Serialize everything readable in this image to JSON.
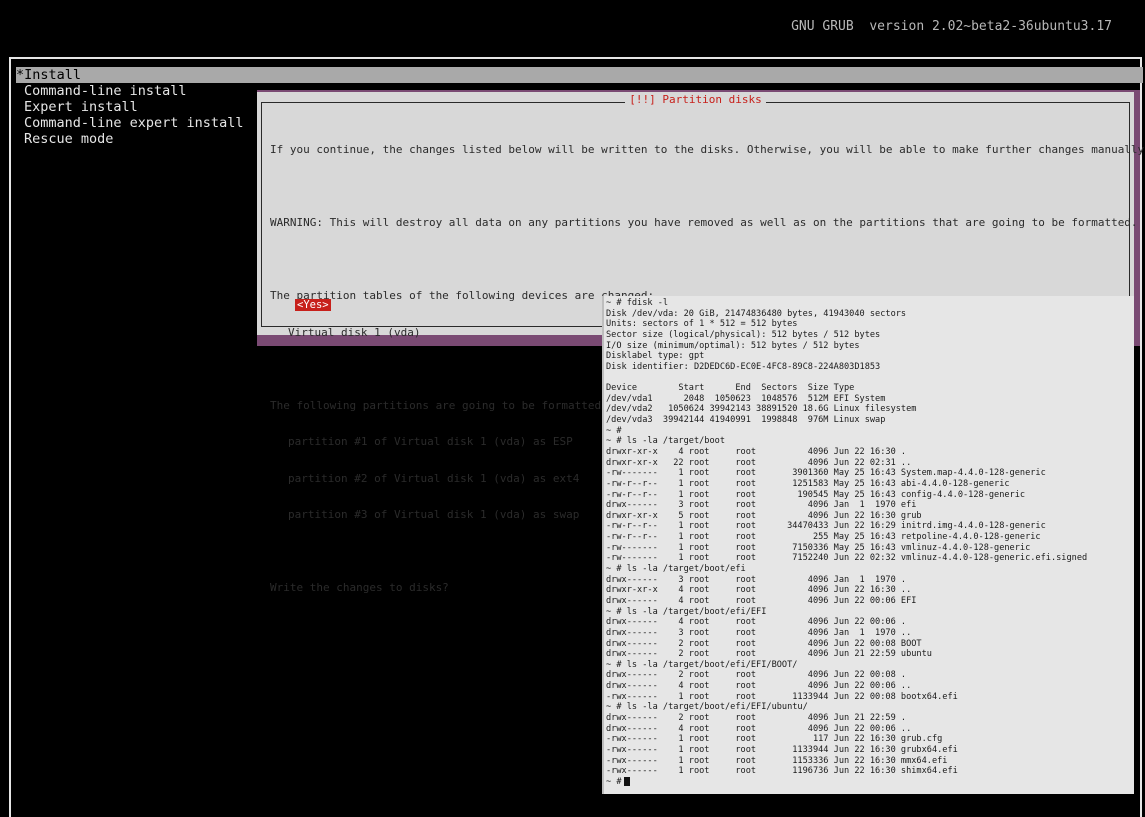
{
  "header": {
    "title": "GNU GRUB  version 2.02~beta2-36ubuntu3.17"
  },
  "menu": {
    "items": [
      {
        "label": "*Install",
        "selected": true
      },
      {
        "label": "Command-line install"
      },
      {
        "label": "Expert install"
      },
      {
        "label": "Command-line expert install"
      },
      {
        "label": "Rescue mode"
      }
    ]
  },
  "dialog": {
    "title": "[!!] Partition disks",
    "intro": "If you continue, the changes listed below will be written to the disks. Otherwise, you will be able to make further changes manually.",
    "warning": "WARNING: This will destroy all data on any partitions you have removed as well as on the partitions that are going to be formatted.",
    "tables_heading": "The partition tables of the following devices are changed:",
    "tables_device": "Virtual disk 1 (vda)",
    "format_heading": "The following partitions are going to be formatted:",
    "format_items": [
      "partition #1 of Virtual disk 1 (vda) as ESP",
      "partition #2 of Virtual disk 1 (vda) as ext4",
      "partition #3 of Virtual disk 1 (vda) as swap"
    ],
    "question": "Write the changes to disks?",
    "yes_label": "<Yes>"
  },
  "terminal": {
    "lines": [
      "~ # fdisk -l",
      "Disk /dev/vda: 20 GiB, 21474836480 bytes, 41943040 sectors",
      "Units: sectors of 1 * 512 = 512 bytes",
      "Sector size (logical/physical): 512 bytes / 512 bytes",
      "I/O size (minimum/optimal): 512 bytes / 512 bytes",
      "Disklabel type: gpt",
      "Disk identifier: D2DEDC6D-EC0E-4FC8-89C8-224A803D1853",
      "",
      "Device        Start      End  Sectors  Size Type",
      "/dev/vda1      2048  1050623  1048576  512M EFI System",
      "/dev/vda2   1050624 39942143 38891520 18.6G Linux filesystem",
      "/dev/vda3  39942144 41940991  1998848  976M Linux swap",
      "~ #",
      "~ # ls -la /target/boot",
      "drwxr-xr-x    4 root     root          4096 Jun 22 16:30 .",
      "drwxr-xr-x   22 root     root          4096 Jun 22 02:31 ..",
      "-rw-------    1 root     root       3901360 May 25 16:43 System.map-4.4.0-128-generic",
      "-rw-r--r--    1 root     root       1251583 May 25 16:43 abi-4.4.0-128-generic",
      "-rw-r--r--    1 root     root        190545 May 25 16:43 config-4.4.0-128-generic",
      "drwx------    3 root     root          4096 Jan  1  1970 efi",
      "drwxr-xr-x    5 root     root          4096 Jun 22 16:30 grub",
      "-rw-r--r--    1 root     root      34470433 Jun 22 16:29 initrd.img-4.4.0-128-generic",
      "-rw-r--r--    1 root     root           255 May 25 16:43 retpoline-4.4.0-128-generic",
      "-rw-------    1 root     root       7150336 May 25 16:43 vmlinuz-4.4.0-128-generic",
      "-rw-------    1 root     root       7152240 Jun 22 02:32 vmlinuz-4.4.0-128-generic.efi.signed",
      "~ # ls -la /target/boot/efi",
      "drwx------    3 root     root          4096 Jan  1  1970 .",
      "drwxr-xr-x    4 root     root          4096 Jun 22 16:30 ..",
      "drwx------    4 root     root          4096 Jun 22 00:06 EFI",
      "~ # ls -la /target/boot/efi/EFI",
      "drwx------    4 root     root          4096 Jun 22 00:06 .",
      "drwx------    3 root     root          4096 Jan  1  1970 ..",
      "drwx------    2 root     root          4096 Jun 22 00:08 BOOT",
      "drwx------    2 root     root          4096 Jun 21 22:59 ubuntu",
      "~ # ls -la /target/boot/efi/EFI/BOOT/",
      "drwx------    2 root     root          4096 Jun 22 00:08 .",
      "drwx------    4 root     root          4096 Jun 22 00:06 ..",
      "-rwx------    1 root     root       1133944 Jun 22 00:08 bootx64.efi",
      "~ # ls -la /target/boot/efi/EFI/ubuntu/",
      "drwx------    2 root     root          4096 Jun 21 22:59 .",
      "drwx------    4 root     root          4096 Jun 22 00:06 ..",
      "-rwx------    1 root     root           117 Jun 22 16:30 grub.cfg",
      "-rwx------    1 root     root       1133944 Jun 22 16:30 grubx64.efi",
      "-rwx------    1 root     root       1153336 Jun 22 16:30 mmx64.efi",
      "-rwx------    1 root     root       1196736 Jun 22 16:30 shimx64.efi"
    ],
    "prompt": "~ #"
  }
}
